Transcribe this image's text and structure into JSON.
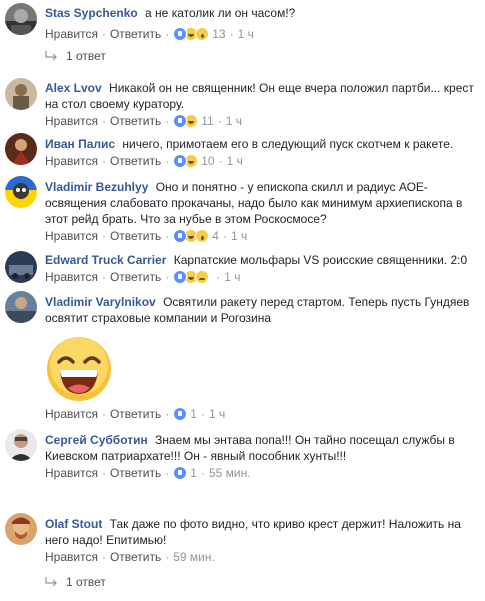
{
  "actions": {
    "like": "Нравится",
    "reply": "Ответить"
  },
  "comments": [
    {
      "author": "Stas Sypchenko",
      "text": "а не католик ли он часом!?",
      "reactions": [
        "like",
        "haha",
        "wow"
      ],
      "count": "13",
      "time": "1 ч",
      "replies": "1 ответ"
    },
    {
      "author": "Alex Lvov",
      "text": "Никакой он не священник! Он еще вчера положил партби... крест на стол своему куратору.",
      "reactions": [
        "like",
        "haha"
      ],
      "count": "11",
      "time": "1 ч"
    },
    {
      "author": "Иван Палис",
      "text": "ничего, примотаем его в следующий пуск скотчем к ракете.",
      "reactions": [
        "like",
        "haha"
      ],
      "count": "10",
      "time": "1 ч"
    },
    {
      "author": "Vladimir Bezuhlyy",
      "text": "Оно и понятно - у епископа скилл и радиус АОЕ-освящения слабовато прокачаны, надо было как минимум архиепископа в этот рейд брать. Что за нубье в этом Роскосмосе?",
      "reactions": [
        "like",
        "haha",
        "wow"
      ],
      "count": "4",
      "time": "1 ч"
    },
    {
      "author": "Edward Truck Carrier",
      "text": "Карпатские мольфары VS роисские священники. 2:0",
      "reactions": [
        "like",
        "haha",
        "sad"
      ],
      "count": "",
      "time": "1 ч"
    },
    {
      "author": "Vladimir Varylnikov",
      "text": "Освятили ракету перед стартом. Теперь пусть Гундяев освятит страховые компании и Рогозина",
      "reactions": [
        "like"
      ],
      "count": "1",
      "time": "1 ч"
    },
    {
      "author": "Сергей Субботин",
      "text": "Знаем мы энтава попа!!! Он тайно посещал службы в Киевском патриархате!!! Он - явный пособник хунты!!!",
      "reactions": [
        "like"
      ],
      "count": "1",
      "time": "55 мин."
    },
    {
      "author": "Olaf Stout",
      "text": "Так даже по фото видно, что криво крест держит! Наложить на него надо! Епитимью!",
      "reactions": [],
      "count": "",
      "time": "59 мин.",
      "replies": "1 ответ"
    }
  ],
  "colors": {
    "author": "#365899",
    "meta": "#90949c",
    "like": "#5890ff",
    "emoji": "#f7cc45"
  }
}
